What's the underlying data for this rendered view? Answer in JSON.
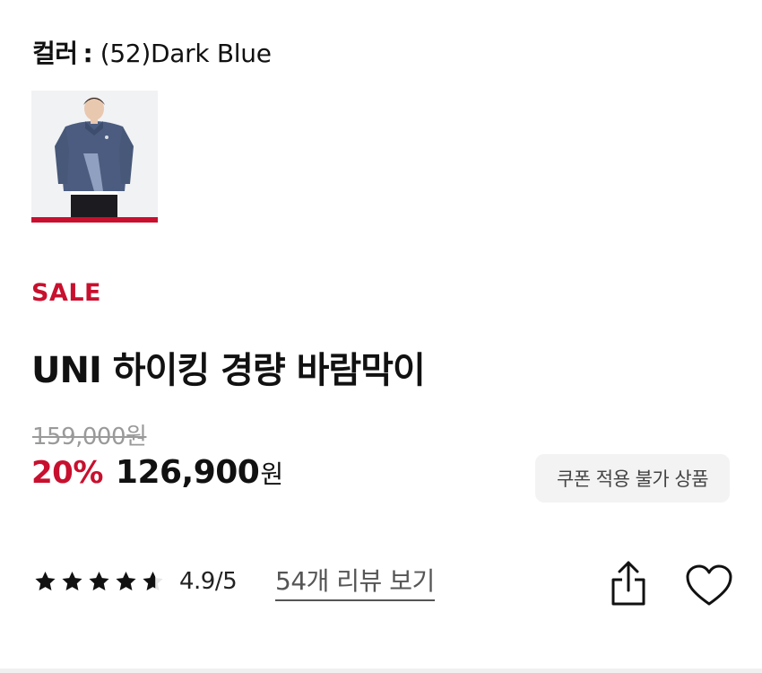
{
  "color_option": {
    "label": "컬러",
    "separator": ":",
    "value": "(52)Dark Blue"
  },
  "swatch": {
    "icon": "product-thumbnail-dark-blue-jacket",
    "selected": true
  },
  "sale_label": "SALE",
  "product": {
    "title": "UNI 하이킹 경량 바람막이"
  },
  "pricing": {
    "original_price": "159,000원",
    "discount": "20%",
    "sale_price": "126,900",
    "currency": "원"
  },
  "coupon_badge": "쿠폰 적용 불가 상품",
  "rating": {
    "score": 4.9,
    "max": 5,
    "text": "4.9/5",
    "review_link": "54개 리뷰 보기"
  },
  "actions": {
    "share_icon": "share-icon",
    "wishlist_icon": "heart-icon"
  },
  "colors": {
    "accent": "#c8102e",
    "text": "#111111",
    "muted": "#9a9a9a",
    "badge_bg": "#f3f3f3"
  }
}
